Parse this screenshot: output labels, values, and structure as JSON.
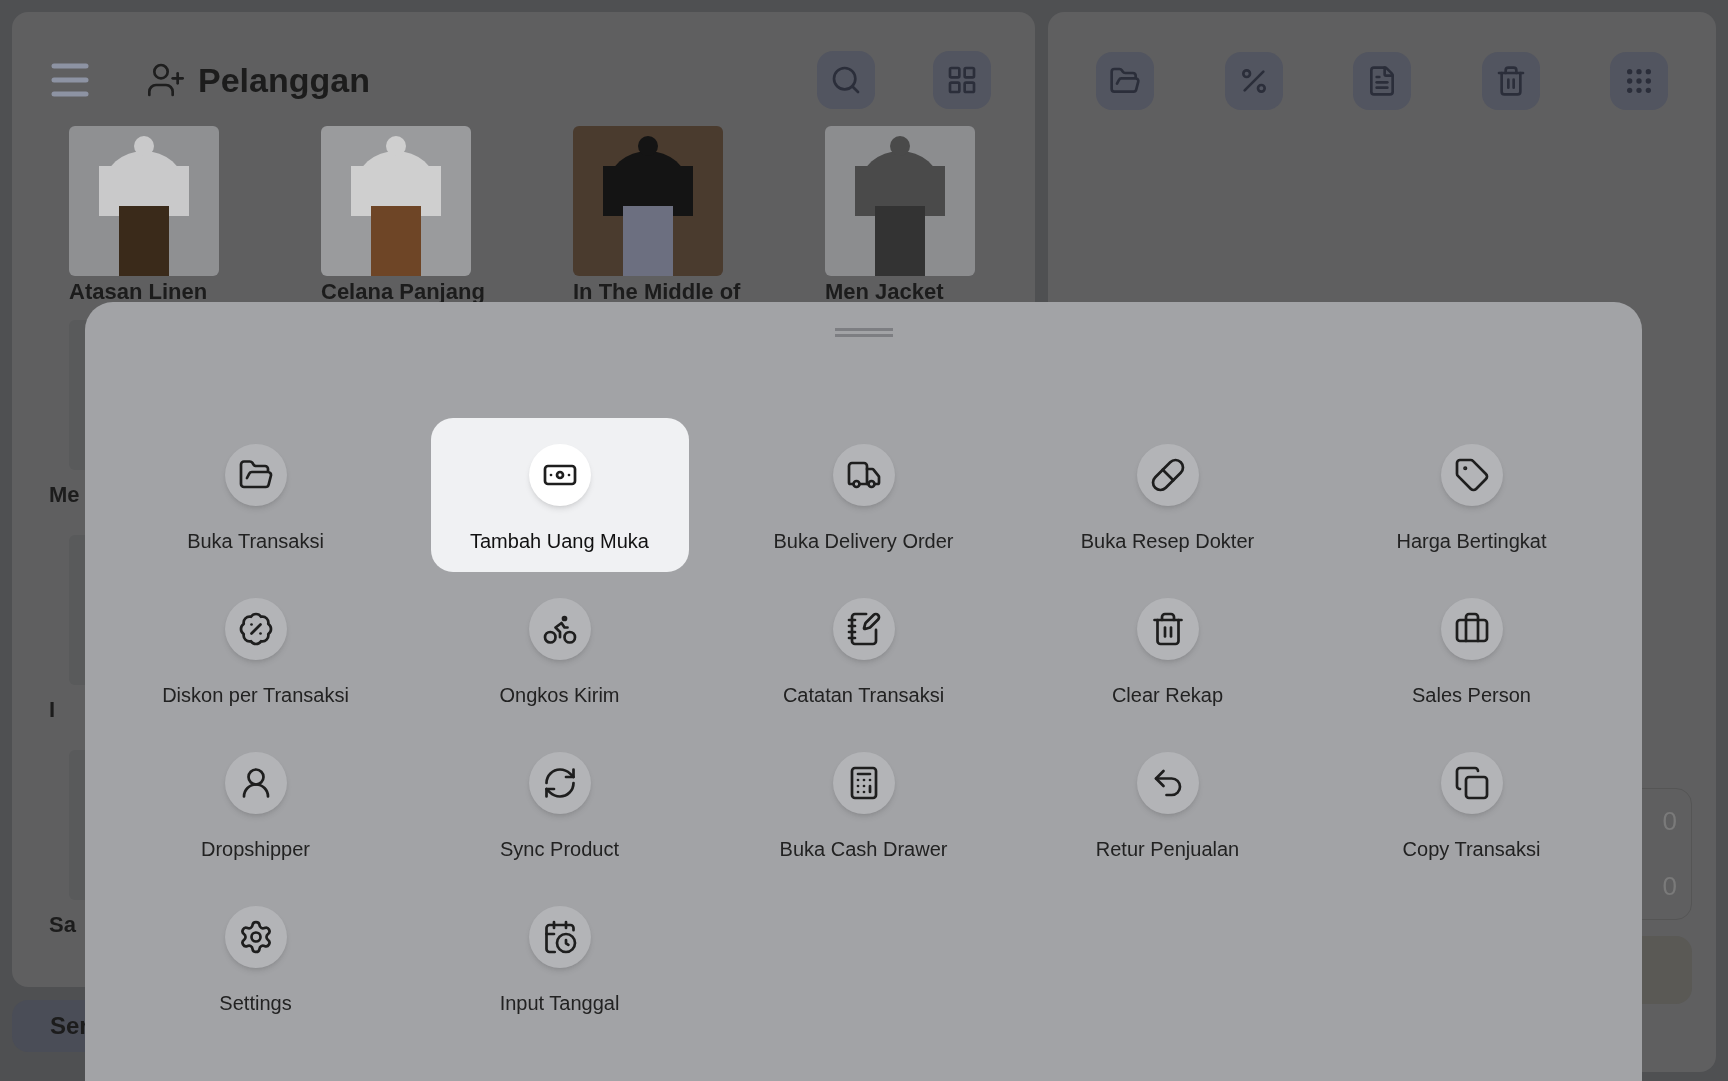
{
  "header": {
    "title": "Pelanggan"
  },
  "products": [
    {
      "name": "Atasan Linen"
    },
    {
      "name": "Celana Panjang"
    },
    {
      "name": "In The Middle of"
    },
    {
      "name": "Men Jacket"
    }
  ],
  "left_column_items": [
    {
      "name": "Me"
    },
    {
      "name": "I"
    },
    {
      "name": "Sa"
    }
  ],
  "bottom_button": {
    "label": "Ser"
  },
  "summary": {
    "values": [
      "0",
      "0"
    ]
  },
  "menu_sheet": {
    "items": [
      {
        "label": "Buka Transaksi",
        "selected": false
      },
      {
        "label": "Tambah Uang Muka",
        "selected": true
      },
      {
        "label": "Buka Delivery Order",
        "selected": false
      },
      {
        "label": "Buka Resep Dokter",
        "selected": false
      },
      {
        "label": "Harga Bertingkat",
        "selected": false
      },
      {
        "label": "Diskon per Transaksi",
        "selected": false
      },
      {
        "label": "Ongkos Kirim",
        "selected": false
      },
      {
        "label": "Catatan Transaksi",
        "selected": false
      },
      {
        "label": "Clear Rekap",
        "selected": false
      },
      {
        "label": "Sales Person",
        "selected": false
      },
      {
        "label": "Dropshipper",
        "selected": false
      },
      {
        "label": "Sync Product",
        "selected": false
      },
      {
        "label": "Buka Cash Drawer",
        "selected": false
      },
      {
        "label": "Retur Penjualan",
        "selected": false
      },
      {
        "label": "Copy Transaksi",
        "selected": false
      },
      {
        "label": "Settings",
        "selected": false
      },
      {
        "label": "Input Tanggal",
        "selected": false
      }
    ]
  }
}
